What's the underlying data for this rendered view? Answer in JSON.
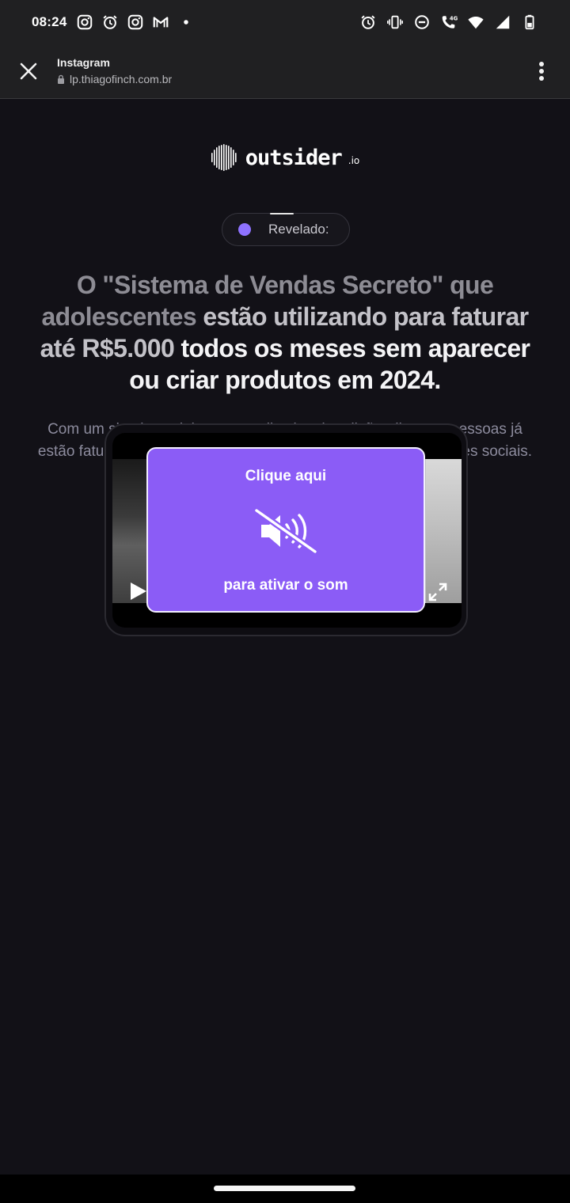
{
  "status_bar": {
    "time": "08:24",
    "left_icons": [
      "instagram-icon",
      "alarm-icon",
      "instagram-icon",
      "gmail-icon",
      "dot-icon"
    ],
    "right_icons": [
      "alarm-icon",
      "vibrate-icon",
      "do-not-disturb-icon",
      "call-4g-icon",
      "wifi-icon",
      "cell-signal-icon",
      "battery-icon"
    ],
    "network_label": "4G"
  },
  "browser": {
    "title": "Instagram",
    "url": "lp.thiagofinch.com.br"
  },
  "logo": {
    "text": "outsider",
    "suffix": ".io"
  },
  "badge": {
    "text": "Revelado:",
    "dot_color": "#8e72ff"
  },
  "headline": {
    "part1": "O \"Sistema de Vendas Secreto\" que",
    "part2": "adolescentes",
    "part3": "estão utilizando para faturar até",
    "part4": "R$5.000",
    "part5": "todos os meses sem aparecer ou",
    "part6": "criar produtos em 2024."
  },
  "subtext": "Com um simples celular e um aplicativo de edição, diversas pessoas já estão faturando mensalmente utilizando minha imagem nas redes sociais.",
  "video": {
    "overlay_top": "Clique aqui",
    "overlay_bottom": "para ativar o som",
    "overlay_color": "#8b5cf6"
  }
}
